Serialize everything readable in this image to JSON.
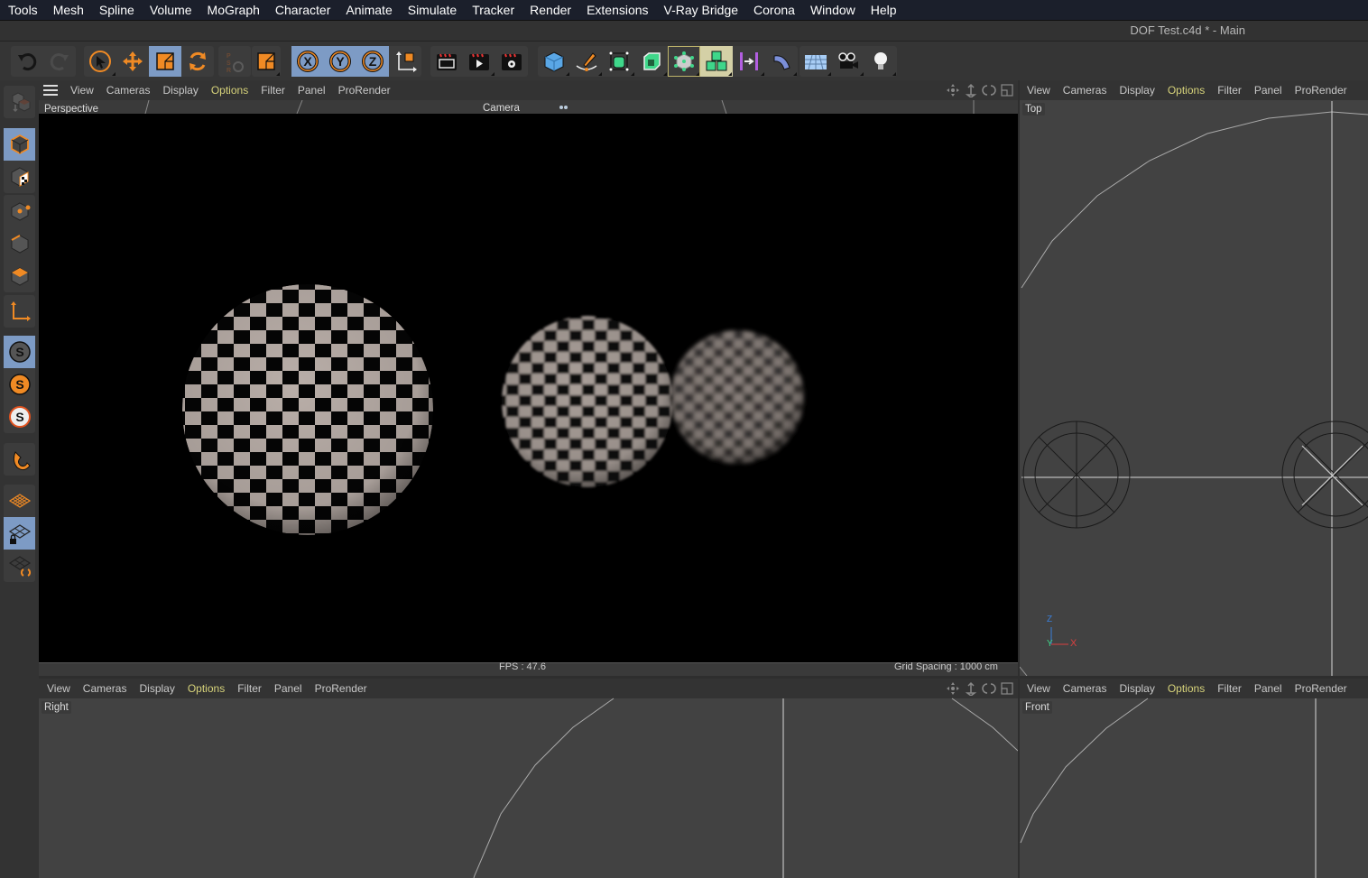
{
  "app": {
    "window_title": "DOF Test.c4d * - Main"
  },
  "menubar": [
    "Tools",
    "Mesh",
    "Spline",
    "Volume",
    "MoGraph",
    "Character",
    "Animate",
    "Simulate",
    "Tracker",
    "Render",
    "Extensions",
    "V-Ray Bridge",
    "Corona",
    "Window",
    "Help"
  ],
  "toolbar": {
    "groups": [
      {
        "items": [
          {
            "icon": "undo-icon"
          },
          {
            "icon": "redo-icon",
            "disabled": true
          }
        ]
      },
      {
        "items": [
          {
            "icon": "live-selection-icon"
          },
          {
            "icon": "move-icon"
          },
          {
            "icon": "scale-icon",
            "selected": true
          },
          {
            "icon": "rotate-icon"
          }
        ]
      },
      {
        "items": [
          {
            "icon": "psr-lock-icon",
            "disabled": true
          }
        ]
      },
      {
        "items": [
          {
            "icon": "recent-tool-icon"
          }
        ]
      },
      {
        "items": [
          {
            "icon": "x-axis-lock-icon",
            "label": "X",
            "selected": true
          },
          {
            "icon": "y-axis-lock-icon",
            "label": "Y",
            "selected": true
          },
          {
            "icon": "z-axis-lock-icon",
            "label": "Z",
            "selected": true
          },
          {
            "icon": "coordinate-system-icon"
          }
        ]
      },
      {
        "items": [
          {
            "icon": "render-view-icon"
          },
          {
            "icon": "render-to-picture-viewer-icon"
          },
          {
            "icon": "render-settings-icon"
          }
        ]
      },
      {
        "items": [
          {
            "icon": "cube-icon"
          },
          {
            "icon": "pen-spline-icon"
          },
          {
            "icon": "subdivision-surface-icon"
          },
          {
            "icon": "extrude-icon"
          },
          {
            "icon": "deformer-icon",
            "outlined": true
          },
          {
            "icon": "cloner-icon",
            "highlighted": true
          },
          {
            "icon": "symmetry-icon"
          },
          {
            "icon": "bend-deformer-icon"
          }
        ]
      },
      {
        "items": [
          {
            "icon": "floor-icon"
          },
          {
            "icon": "camera-icon"
          },
          {
            "icon": "light-icon"
          }
        ]
      }
    ]
  },
  "leftbar": {
    "tools": [
      "make-editable-icon",
      "model-mode-icon",
      "texture-mode-icon",
      "points-mode-icon",
      "edges-mode-icon",
      "polygons-mode-icon",
      "axis-mode-icon",
      "solo-off-icon",
      "solo-single-icon",
      "solo-hierarchy-icon",
      "snap-icon",
      "workplane-icon",
      "locked-workplane-icon",
      "workplane-align-icon"
    ]
  },
  "viewport_menu": [
    "View",
    "Cameras",
    "Display",
    "Options",
    "Filter",
    "Panel",
    "ProRender"
  ],
  "viewport_menu_highlight": "Options",
  "accent_color": "#d6d27a",
  "viewports": {
    "perspective": {
      "label": "Perspective",
      "camera": "Camera",
      "fps": "FPS : 47.6",
      "grid_spacing": "Grid Spacing : 1000 cm"
    },
    "top": {
      "label": "Top",
      "axis": {
        "z": "Z",
        "y": "Y",
        "x": "X"
      }
    },
    "right": {
      "label": "Right"
    },
    "front": {
      "label": "Front"
    }
  }
}
